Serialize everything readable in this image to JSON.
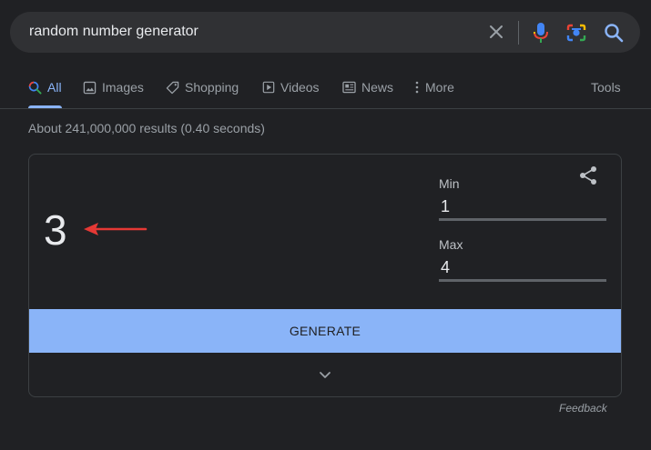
{
  "search": {
    "query": "random number generator"
  },
  "tabs": [
    {
      "label": "All",
      "icon": "search-icon",
      "active": true
    },
    {
      "label": "Images",
      "icon": "image-icon"
    },
    {
      "label": "Shopping",
      "icon": "tag-icon"
    },
    {
      "label": "Videos",
      "icon": "play-icon"
    },
    {
      "label": "News",
      "icon": "newspaper-icon"
    },
    {
      "label": "More",
      "icon": "more-vert-icon"
    }
  ],
  "tools_label": "Tools",
  "result_stats": "About 241,000,000 results (0.40 seconds)",
  "generator": {
    "result": "3",
    "min_label": "Min",
    "min_value": "1",
    "max_label": "Max",
    "max_value": "4",
    "generate_label": "GENERATE"
  },
  "feedback_label": "Feedback",
  "colors": {
    "background": "#202124",
    "accent": "#8ab4f8",
    "annotation_arrow": "#e53935"
  }
}
